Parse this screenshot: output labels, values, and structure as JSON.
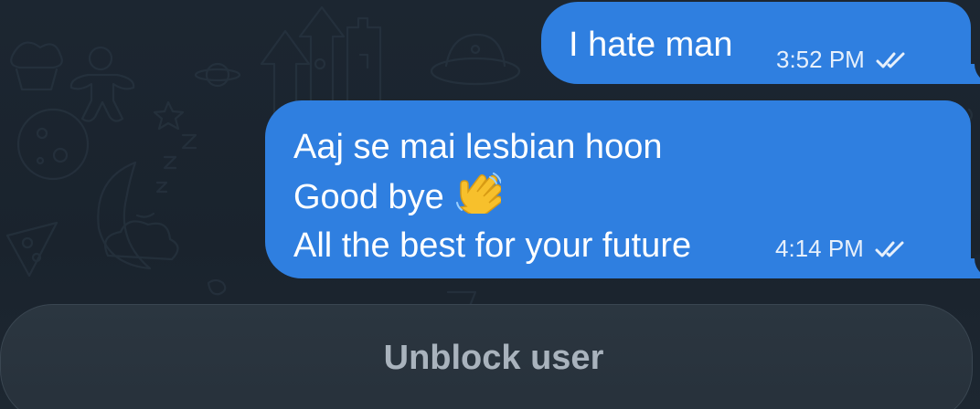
{
  "messages": [
    {
      "lines": [
        "I hate man"
      ],
      "time": "3:52 PM",
      "status_icon": "double-check-icon"
    },
    {
      "lines": [
        "Aaj se mai lesbian hoon",
        "Good bye",
        "All the best for your future"
      ],
      "emoji": "waving-hand-emoji",
      "time": "4:14 PM",
      "status_icon": "double-check-icon"
    }
  ],
  "footer": {
    "unblock_label": "Unblock user"
  },
  "colors": {
    "bubble": "#2f7fe0",
    "background": "#1b2530",
    "footer_text": "#a9b3bd"
  }
}
